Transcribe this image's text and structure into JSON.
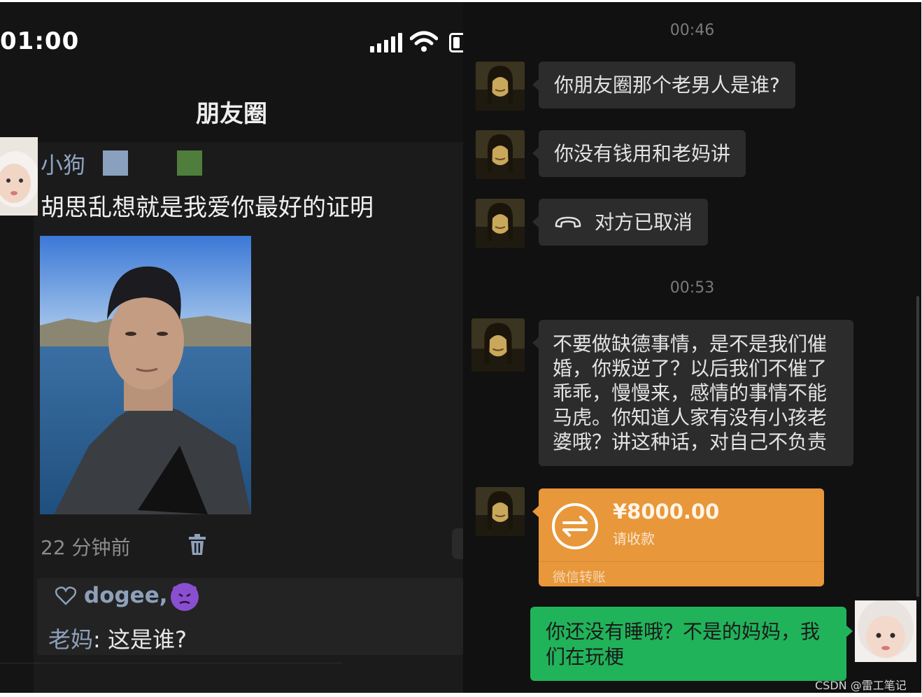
{
  "status_bar": {
    "time": "01:00"
  },
  "moments": {
    "title": "朋友圈",
    "poster_name": "小狗",
    "post_text": "胡思乱想就是我爱你最好的证明",
    "post_time": "22 分钟前",
    "likers": "dogee,",
    "comment_author": "老妈",
    "comment_sep": ": ",
    "comment_text": "这是谁?"
  },
  "chat": {
    "timestamp_1": "00:46",
    "msg_1": "你朋友圈那个老男人是谁?",
    "msg_2": "你没有钱用和老妈讲",
    "msg_3": "对方已取消",
    "timestamp_2": "00:53",
    "msg_4": "不要做缺德事情，是不是我们催婚，你叛逆了？以后我们不催了乖乖，慢慢来，感情的事情不能马虎。你知道人家有没有小孩老婆哦？讲这种话，对自己不负责",
    "transfer_amount": "¥8000.00",
    "transfer_sub": "请收款",
    "transfer_footer": "微信转账",
    "reply": "你还没有睡哦？不是的妈妈，我们在玩梗"
  },
  "watermark": "CSDN @雷工笔记",
  "colors": {
    "transfer": "#e8973a",
    "sent_bubble": "#21b35a",
    "received_bubble": "#2c2c2c"
  }
}
